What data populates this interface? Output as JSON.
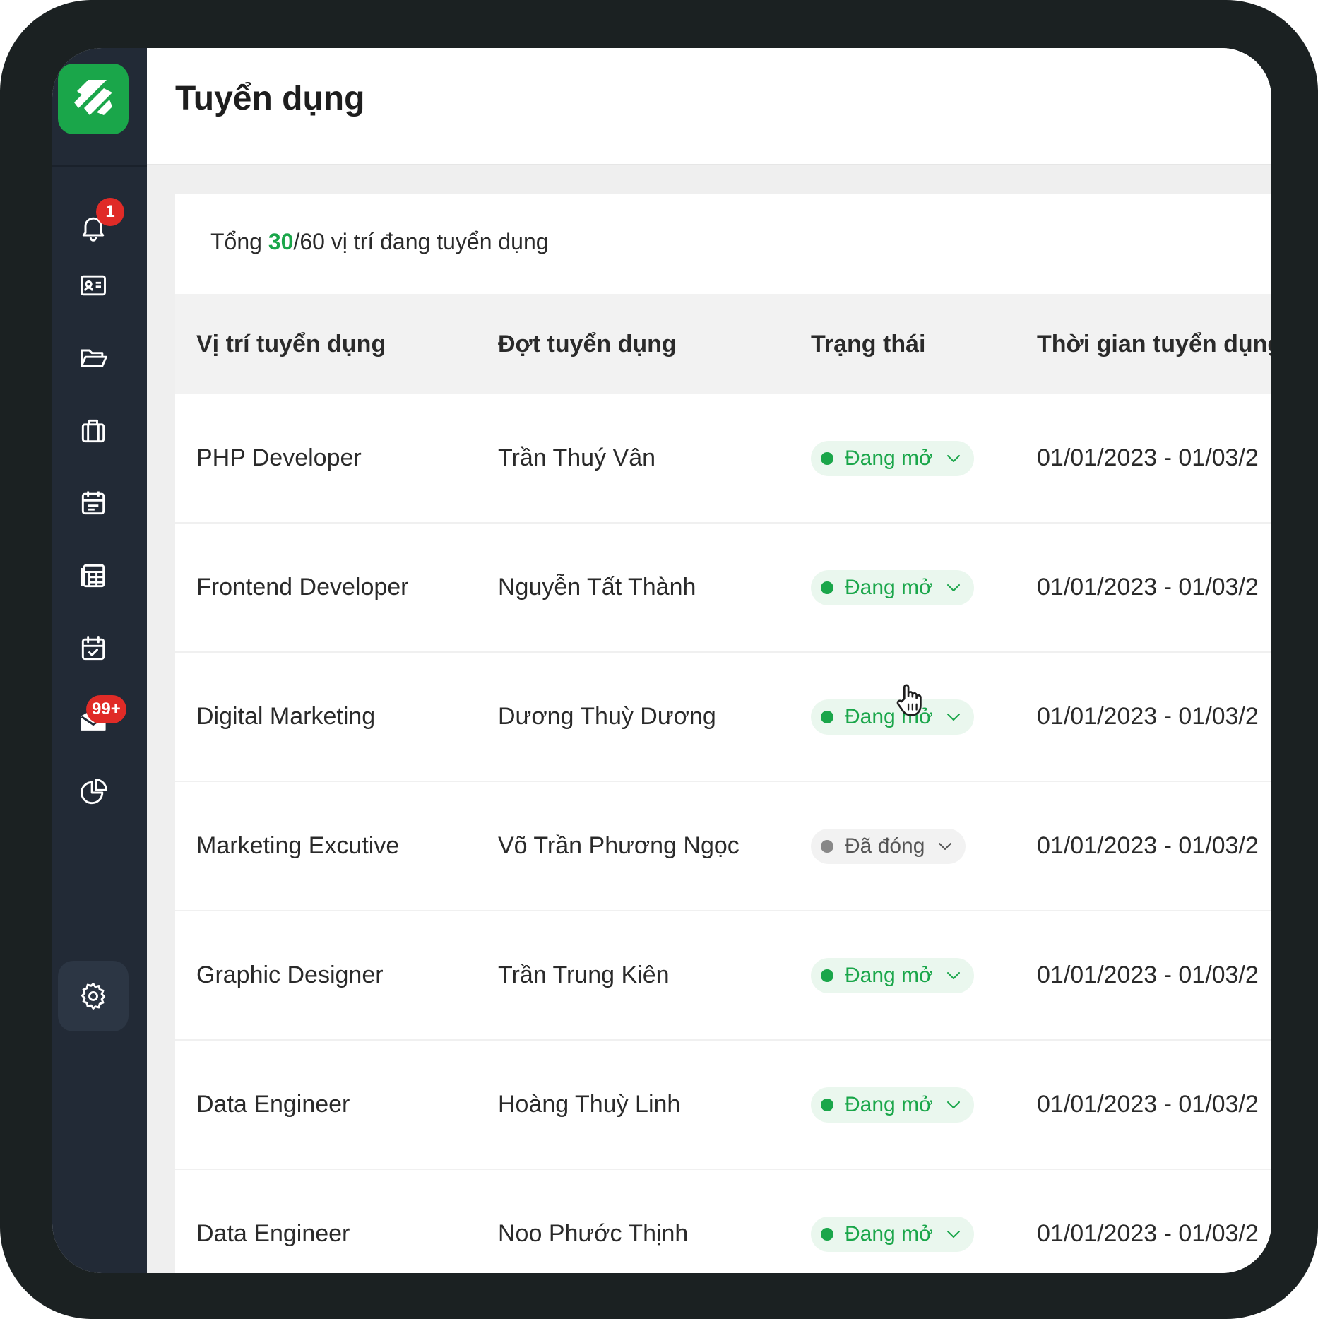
{
  "colors": {
    "frame": "#1b2122",
    "sidebar": "#222a36",
    "brand_green": "#1aa64a",
    "badge_red": "#e02b27"
  },
  "sidebar": {
    "logo_icon": "brand-logo",
    "items": [
      {
        "icon": "bell-icon",
        "badge": "1"
      },
      {
        "icon": "id-card-icon"
      },
      {
        "icon": "folder-icon"
      },
      {
        "icon": "briefcase-icon"
      },
      {
        "icon": "calendar-icon"
      },
      {
        "icon": "spreadsheet-icon"
      },
      {
        "icon": "calendar-check-icon"
      },
      {
        "icon": "mail-icon",
        "badge": "99+"
      },
      {
        "icon": "pie-chart-icon"
      },
      {
        "icon": "gear-icon",
        "active": true
      }
    ]
  },
  "header": {
    "title": "Tuyển dụng"
  },
  "summary": {
    "prefix": "Tổng ",
    "open_count": "30",
    "rest": "/60 vị trí đang tuyển dụng"
  },
  "table": {
    "columns": [
      "Vị trí tuyển dụng",
      "Đợt tuyển dụng",
      "Trạng thái",
      "Thời gian tuyển dụng"
    ],
    "rows": [
      {
        "position": "PHP Developer",
        "round": "Trần Thuý Vân",
        "status": "Đang mở",
        "status_type": "open",
        "period": "01/01/2023 - 01/03/2"
      },
      {
        "position": "Frontend Developer",
        "round": "Nguyễn Tất Thành",
        "status": "Đang mở",
        "status_type": "open",
        "period": "01/01/2023 - 01/03/2"
      },
      {
        "position": "Digital Marketing",
        "round": "Dương Thuỳ Dương",
        "status": "Đang mở",
        "status_type": "open",
        "period": "01/01/2023 - 01/03/2"
      },
      {
        "position": "Marketing Excutive",
        "round": "Võ Trần Phương Ngọc",
        "status": "Đã đóng",
        "status_type": "closed",
        "period": "01/01/2023 - 01/03/2"
      },
      {
        "position": "Graphic Designer",
        "round": "Trần Trung Kiên",
        "status": "Đang mở",
        "status_type": "open",
        "period": "01/01/2023 - 01/03/2"
      },
      {
        "position": "Data Engineer",
        "round": "Hoàng Thuỳ Linh",
        "status": "Đang mở",
        "status_type": "open",
        "period": "01/01/2023 - 01/03/2"
      },
      {
        "position": "Data Engineer",
        "round": "Noo Phước Thịnh",
        "status": "Đang mở",
        "status_type": "open",
        "period": "01/01/2023 - 01/03/2"
      }
    ]
  }
}
